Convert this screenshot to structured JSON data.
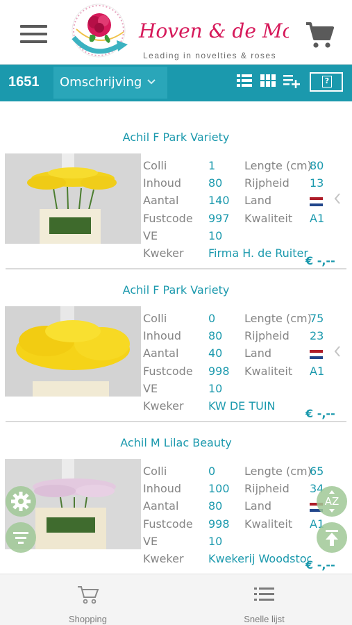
{
  "header": {
    "logo_text": "Hoven & de Mooij",
    "logo_tagline": "Leading in novelties & roses"
  },
  "toolbar": {
    "count": "1651",
    "sort_label": "Omschrijving",
    "help_label": "?"
  },
  "labels": {
    "colli": "Colli",
    "inhoud": "Inhoud",
    "aantal": "Aantal",
    "fustcode": "Fustcode",
    "ve": "VE",
    "kweker": "Kweker",
    "lengte": "Lengte (cm)",
    "rijpheid": "Rijpheid",
    "land": "Land",
    "kwaliteit": "Kwaliteit"
  },
  "products": [
    {
      "title": "Achil F Park Variety",
      "colli": "1",
      "inhoud": "80",
      "aantal": "140",
      "fustcode": "997",
      "ve": "10",
      "kweker": "Firma H. de Ruiter",
      "lengte": "80",
      "rijpheid": "13",
      "kwaliteit": "A1",
      "price": "€ -,--",
      "flower_color": "#f2d21c"
    },
    {
      "title": "Achil F Park Variety",
      "colli": "0",
      "inhoud": "80",
      "aantal": "40",
      "fustcode": "998",
      "ve": "10",
      "kweker": "KW DE TUIN",
      "lengte": "75",
      "rijpheid": "23",
      "kwaliteit": "A1",
      "price": "€ -,--",
      "flower_color": "#f5d318"
    },
    {
      "title": "Achil M Lilac Beauty",
      "colli": "0",
      "inhoud": "100",
      "aantal": "80",
      "fustcode": "998",
      "ve": "10",
      "kweker": "Kwekerij Woodstoc",
      "lengte": "65",
      "rijpheid": "34",
      "kwaliteit": "A1",
      "price": "€ -,--",
      "flower_color": "#e3c9df"
    }
  ],
  "fab": {
    "az_label": "AZ"
  },
  "bottombar": {
    "shopping_label": "Shopping",
    "quicklist_label": "Snelle lijst"
  },
  "colors": {
    "accent": "#1b99ad",
    "toolbar": "#1b99ad",
    "logo_pink": "#d6195a"
  }
}
